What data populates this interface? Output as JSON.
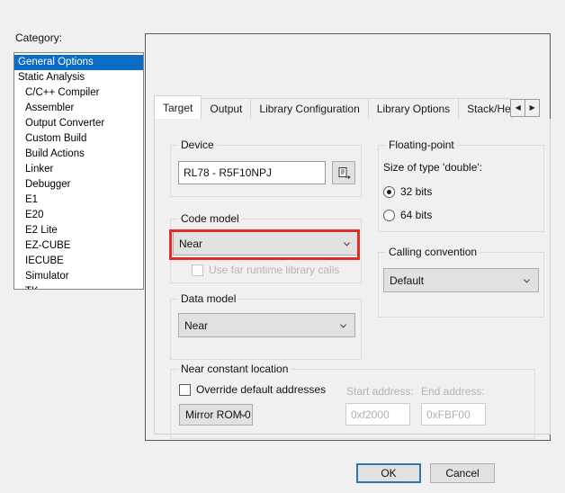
{
  "category": {
    "label": "Category:",
    "items": [
      {
        "label": "General Options",
        "selected": true,
        "indent": false
      },
      {
        "label": "Static Analysis",
        "selected": false,
        "indent": false
      },
      {
        "label": "C/C++ Compiler",
        "selected": false,
        "indent": true
      },
      {
        "label": "Assembler",
        "selected": false,
        "indent": true
      },
      {
        "label": "Output Converter",
        "selected": false,
        "indent": true
      },
      {
        "label": "Custom Build",
        "selected": false,
        "indent": true
      },
      {
        "label": "Build Actions",
        "selected": false,
        "indent": true
      },
      {
        "label": "Linker",
        "selected": false,
        "indent": true
      },
      {
        "label": "Debugger",
        "selected": false,
        "indent": true
      },
      {
        "label": "E1",
        "selected": false,
        "indent": true
      },
      {
        "label": "E20",
        "selected": false,
        "indent": true
      },
      {
        "label": "E2 Lite",
        "selected": false,
        "indent": true
      },
      {
        "label": "EZ-CUBE",
        "selected": false,
        "indent": true
      },
      {
        "label": "IECUBE",
        "selected": false,
        "indent": true
      },
      {
        "label": "Simulator",
        "selected": false,
        "indent": true
      },
      {
        "label": "TK",
        "selected": false,
        "indent": true
      }
    ]
  },
  "tabs": {
    "items": [
      {
        "label": "Target",
        "active": true
      },
      {
        "label": "Output",
        "active": false
      },
      {
        "label": "Library Configuration",
        "active": false
      },
      {
        "label": "Library Options",
        "active": false
      },
      {
        "label": "Stack/Hea",
        "active": false
      }
    ],
    "scroll_left_icon": "◀",
    "scroll_right_icon": "▶"
  },
  "target": {
    "device": {
      "title": "Device",
      "value": "RL78 - R5F10NPJ",
      "picker_icon": "device-picker-icon"
    },
    "code_model": {
      "title": "Code model",
      "value": "Near",
      "far_runtime": {
        "label": "Use far runtime library calls",
        "checked": false,
        "disabled": true
      }
    },
    "data_model": {
      "title": "Data model",
      "value": "Near"
    },
    "near_constant_location": {
      "title": "Near constant location",
      "override": {
        "label": "Override default addresses",
        "checked": false
      },
      "mirror": "Mirror ROM 0",
      "start_label": "Start address:",
      "start_value": "0xf2000",
      "end_label": "End address:",
      "end_value": "0xFBF00"
    },
    "floating_point": {
      "title": "Floating-point",
      "subtitle": "Size of type 'double':",
      "options": [
        {
          "label": "32 bits",
          "checked": true
        },
        {
          "label": "64 bits",
          "checked": false
        }
      ]
    },
    "calling_convention": {
      "title": "Calling convention",
      "value": "Default"
    }
  },
  "footer": {
    "ok": "OK",
    "cancel": "Cancel"
  },
  "colors": {
    "selection_blue": "#0a6cc4",
    "highlight_red": "#e02c2c",
    "default_button_border": "#2a7ab0",
    "dialog_bg": "#f0f0f0"
  }
}
